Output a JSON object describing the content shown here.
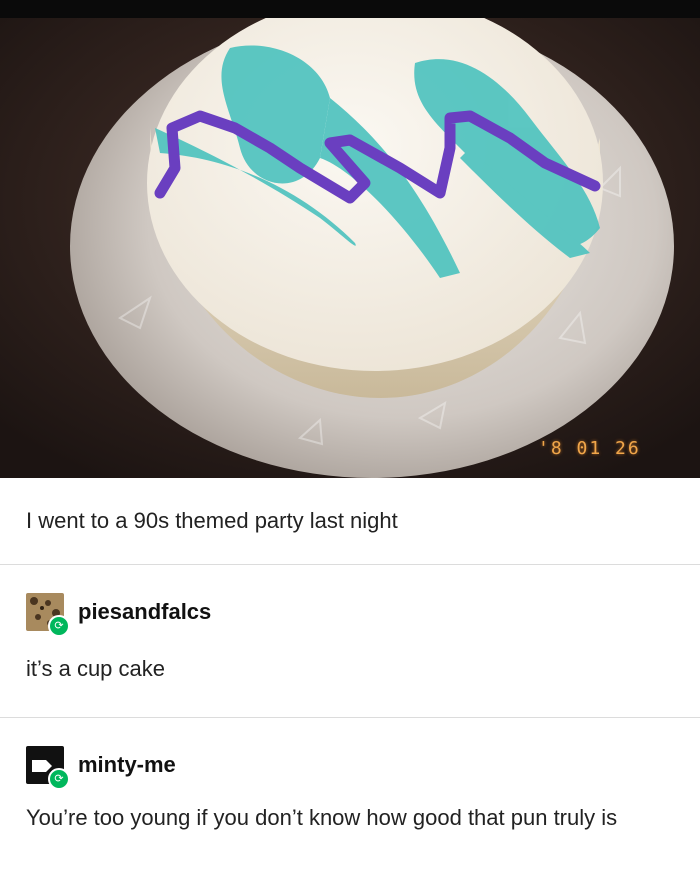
{
  "photo": {
    "description_icon": "cake-photo",
    "date_stamp": "'8 01 26"
  },
  "post": {
    "caption": "I went to a 90s themed party last night"
  },
  "replies": [
    {
      "username": "piesandfalcs",
      "text": "it’s a cup cake",
      "avatar_icon": "leopard-avatar-icon",
      "badge_icon": "reblog-icon"
    },
    {
      "username": "minty-me",
      "text": "You’re too young if you don’t know how good that pun truly is",
      "avatar_icon": "black-avatar-icon",
      "badge_icon": "reblog-icon"
    }
  ],
  "colors": {
    "teal": "#4fc3bf",
    "purple": "#6a3fc0",
    "reblog_green": "#00b75c",
    "stamp_orange": "#f0a64a"
  }
}
